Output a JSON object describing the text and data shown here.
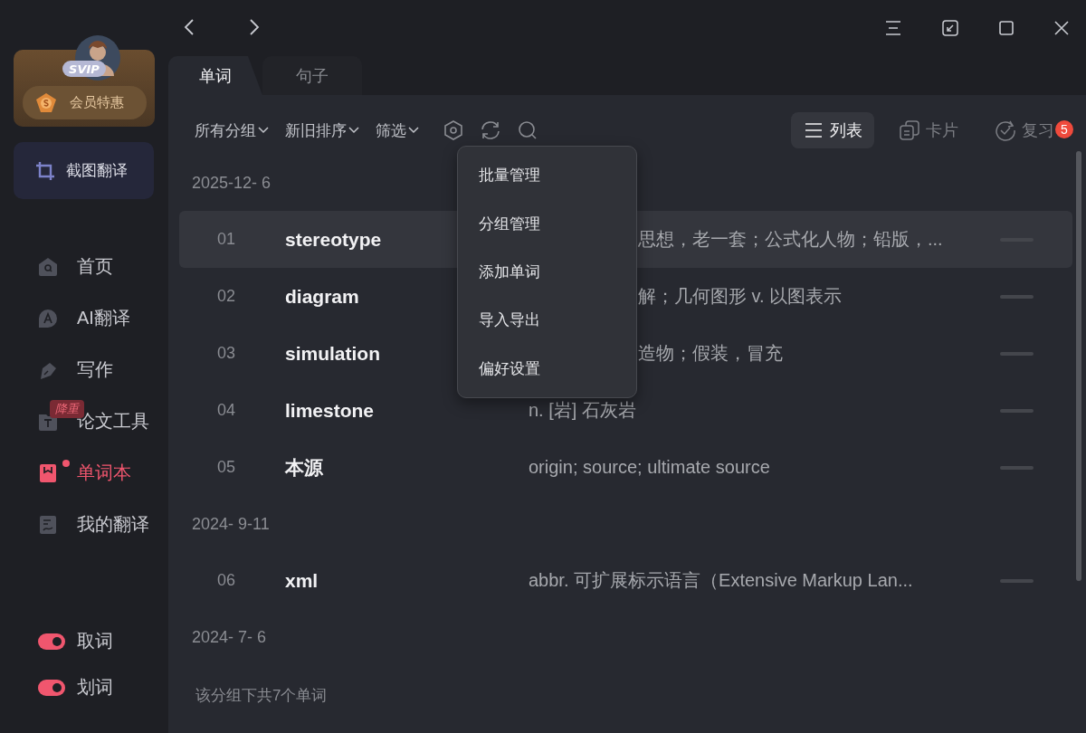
{
  "profile": {
    "badge": "SVIP",
    "offer": "会员特惠"
  },
  "screenshot_button": "截图翻译",
  "sidebar": {
    "items": [
      {
        "kind": "home",
        "label": "首页",
        "selected": false
      },
      {
        "kind": "ai",
        "label": "AI翻译",
        "selected": false
      },
      {
        "kind": "write",
        "label": "写作",
        "selected": false
      },
      {
        "kind": "paper",
        "label": "论文工具",
        "selected": false,
        "badge": "降重"
      },
      {
        "kind": "book",
        "label": "单词本",
        "selected": true,
        "dot": true
      },
      {
        "kind": "mine",
        "label": "我的翻译",
        "selected": false
      }
    ]
  },
  "toggles": [
    {
      "label": "取词",
      "on": true
    },
    {
      "label": "划词",
      "on": true
    }
  ],
  "tabs": [
    {
      "label": "单词",
      "selected": true
    },
    {
      "label": "句子",
      "selected": false
    }
  ],
  "toolbar": {
    "filters": [
      "所有分组",
      "新旧排序",
      "筛选"
    ],
    "views": [
      {
        "kind": "list",
        "label": "列表",
        "selected": true
      },
      {
        "kind": "card",
        "label": "卡片",
        "selected": false
      },
      {
        "kind": "review",
        "label": "复习",
        "selected": false,
        "badge": "5"
      }
    ]
  },
  "groups": [
    {
      "date": "2025-12- 6",
      "rows": [
        {
          "number": "01",
          "word": "stereotype",
          "meaning": "思想，老一套；公式化人物；铅版，...",
          "highlighted": true
        },
        {
          "number": "02",
          "word": "diagram",
          "meaning": "解；几何图形 v. 以图表示",
          "highlighted": false
        },
        {
          "number": "03",
          "word": "simulation",
          "meaning": "造物；假装，冒充",
          "highlighted": false
        },
        {
          "number": "04",
          "word": "limestone",
          "meaning": "n. [岩] 石灰岩",
          "highlighted": false
        },
        {
          "number": "05",
          "word": "本源",
          "meaning": "origin; source; ultimate source",
          "highlighted": false
        }
      ]
    },
    {
      "date": "2024- 9-11",
      "rows": [
        {
          "number": "06",
          "word": "xml",
          "meaning": "abbr. 可扩展标示语言（Extensive Markup Lan...",
          "highlighted": false
        }
      ]
    },
    {
      "date": "2024- 7- 6"
    }
  ],
  "footer": "该分组下共7个单词",
  "menu": {
    "items": [
      "批量管理",
      "分组管理",
      "添加单词",
      "导入导出",
      "偏好设置"
    ]
  }
}
